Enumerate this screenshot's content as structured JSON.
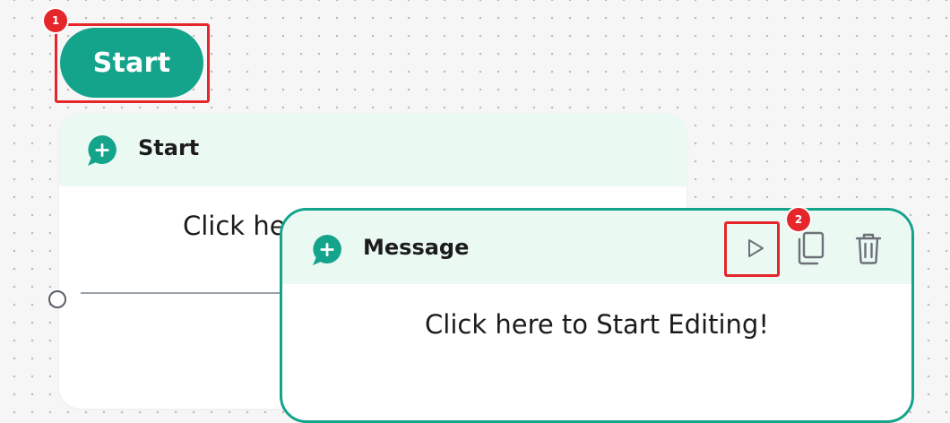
{
  "start_node": {
    "label": "Start"
  },
  "badges": {
    "first": "1",
    "second": "2"
  },
  "start_card": {
    "title": "Start",
    "body": "Click here to Start Editing!",
    "icon": "chat-plus-icon"
  },
  "message_card": {
    "title": "Message",
    "body": "Click here to Start Editing!",
    "icon": "chat-plus-icon",
    "toolbar": {
      "play_icon": "play-icon",
      "copy_icon": "copy-icon",
      "delete_icon": "trash-icon"
    }
  },
  "colors": {
    "accent": "#14a38b",
    "header_bg": "#ebf9f3",
    "highlight": "#e5262a"
  }
}
